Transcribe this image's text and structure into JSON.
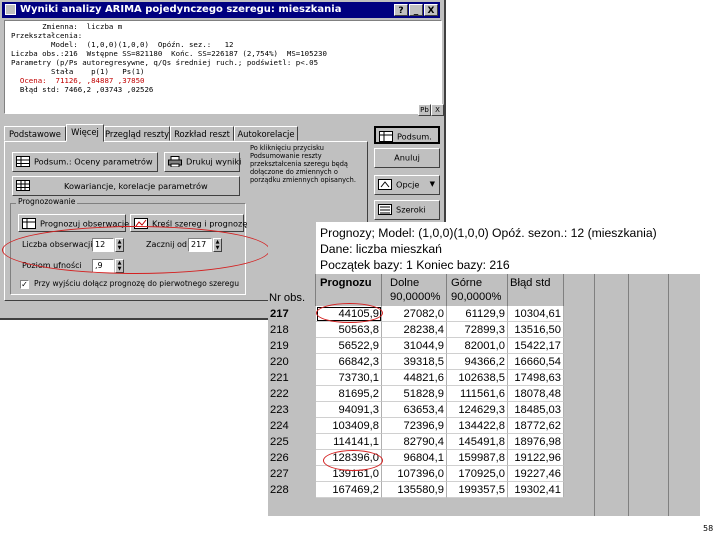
{
  "dialog": {
    "title": "Wyniki analizy ARIMA pojedynczego szeregu: mieszkania",
    "title_buttons": [
      "?",
      "_",
      "X"
    ],
    "output_lines": [
      "       Zmienna:  liczba m",
      "Przekształcenia:",
      "         Model:  (1,0,0)(1,0,0)  Opóźn. sez.:   12",
      "Liczba obs.:216  Wstępne SS=821180  Końc. SS=226187 (2,754%)  MS=105230",
      "Parametry (p/Ps autoregresywne, q/Qs średniej ruch.; podświetl: p<.05",
      "         Stała    p(1)   Ps(1)",
      "  Ocena:  71126, ,84887 ,37850",
      "  Błąd std: 7466,2 ,03743 ,02526"
    ],
    "side_icons": [
      "Pb",
      "X"
    ],
    "tabs": [
      "Podstawowe",
      "Więcej",
      "Przegląd reszty",
      "Rozkład reszt",
      "Autokorelacje"
    ],
    "active_tab": "Więcej",
    "right_buttons": {
      "summary": "Podsum.",
      "cancel": "Anuluj",
      "options": "Opcje",
      "options_arrow": "▼",
      "print": "Szeroki"
    },
    "panel_buttons": {
      "params_summary": "Podsum.: Oceny parametrów",
      "print_results": "Drukuj wyniki",
      "covariance": "Kowariancje, korelacje parametrów"
    },
    "note": "Po kliknięciu przycisku Podsumowanie reszty przekształcenia szeregu będą dołączone do zmiennych o porządku zmiennych opisanych.",
    "forecast_group": {
      "title": "Prognozowanie",
      "forecast_cases_button": "Prognozuj obserwacje",
      "plot_button": "Kreśl szereg i prognozę",
      "start_label": "Liczba obserwacji",
      "start_value": "12",
      "start_at_label": "Zacznij od",
      "start_at_value": "217",
      "prob_label": "Poziom ufności",
      "prob_value": ",9",
      "append_label": "Przy wyjściu dołącz prognozę do pierwotnego szeregu",
      "append_checked": "✓"
    }
  },
  "sheet": {
    "header_lines": [
      "Prognozy; Model: (1,0,0)(1,0,0) Opóź. sezon.: 12 (mieszkania)",
      "Dane: liczba mieszkań",
      "Początek bazy: 1 Koniec bazy: 216"
    ],
    "corner": "Nr obs.",
    "columns": [
      {
        "name": "Prognozu",
        "sub": ""
      },
      {
        "name": "Dolne",
        "sub": "90,0000%"
      },
      {
        "name": "Górne",
        "sub": "90,0000%"
      },
      {
        "name": "Błąd std",
        "sub": ""
      }
    ],
    "rows": [
      {
        "obs": "217",
        "forecast": "44105,9",
        "lower": "27082,0",
        "upper": "61129,9",
        "se": "10304,61"
      },
      {
        "obs": "218",
        "forecast": "50563,8",
        "lower": "28238,4",
        "upper": "72899,3",
        "se": "13516,50"
      },
      {
        "obs": "219",
        "forecast": "56522,9",
        "lower": "31044,9",
        "upper": "82001,0",
        "se": "15422,17"
      },
      {
        "obs": "220",
        "forecast": "66842,3",
        "lower": "39318,5",
        "upper": "94366,2",
        "se": "16660,54"
      },
      {
        "obs": "221",
        "forecast": "73730,1",
        "lower": "44821,6",
        "upper": "102638,5",
        "se": "17498,63"
      },
      {
        "obs": "222",
        "forecast": "81695,2",
        "lower": "51828,9",
        "upper": "111561,6",
        "se": "18078,48"
      },
      {
        "obs": "223",
        "forecast": "94091,3",
        "lower": "63653,4",
        "upper": "124629,3",
        "se": "18485,03"
      },
      {
        "obs": "224",
        "forecast": "103409,8",
        "lower": "72396,9",
        "upper": "134422,8",
        "se": "18772,62"
      },
      {
        "obs": "225",
        "forecast": "114141,1",
        "lower": "82790,4",
        "upper": "145491,8",
        "se": "18976,98"
      },
      {
        "obs": "226",
        "forecast": "128396,0",
        "lower": "96804,1",
        "upper": "159987,8",
        "se": "19122,96"
      },
      {
        "obs": "227",
        "forecast": "139161,0",
        "lower": "107396,0",
        "upper": "170925,0",
        "se": "19227,46"
      },
      {
        "obs": "228",
        "forecast": "167469,2",
        "lower": "135580,9",
        "upper": "199357,5",
        "se": "19302,41"
      }
    ]
  },
  "page_number": "58",
  "colors": {
    "title_bar": "#000080",
    "annotation": "#d42020",
    "window_face": "#c0c0c0"
  }
}
